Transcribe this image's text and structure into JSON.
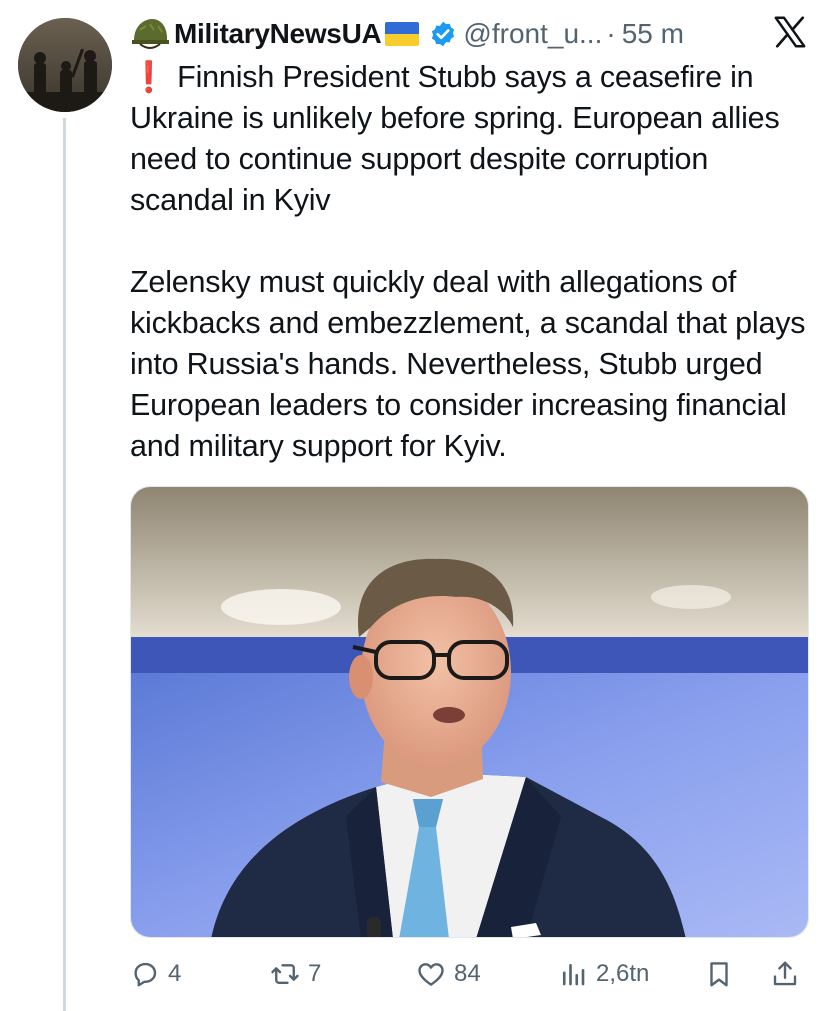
{
  "tweet": {
    "author_name": "MilitaryNewsUA",
    "handle": "@front_u...",
    "separator": "·",
    "time": "55 m",
    "headline_mark": "❗",
    "headline": "Finnish President Stubb says a ceasefire in Ukraine is unlikely before spring. European allies need to continue support despite corruption scandal in Kyiv",
    "paragraph": "Zelensky must quickly deal with allegations of kickbacks and embezzlement, a scandal that plays into Russia's hands. Nevertheless, Stubb urged European leaders to consider increasing financial and military support for Kyiv."
  },
  "actions": {
    "replies": "4",
    "reposts": "7",
    "likes": "84",
    "views": "2,6tn"
  },
  "icons": {
    "author_emoji": "military-helmet-icon",
    "flag": "ukraine-flag-icon",
    "verified": "verified-badge-icon",
    "platform": "x-logo-icon",
    "reply": "reply-icon",
    "repost": "repost-icon",
    "like": "heart-icon",
    "views": "views-chart-icon",
    "bookmark": "bookmark-icon",
    "share": "share-icon"
  },
  "colors": {
    "verified": "#1d9bf0",
    "text_secondary": "#536471",
    "flag_blue": "#2f6cd6",
    "flag_yellow": "#f7cd2d"
  }
}
